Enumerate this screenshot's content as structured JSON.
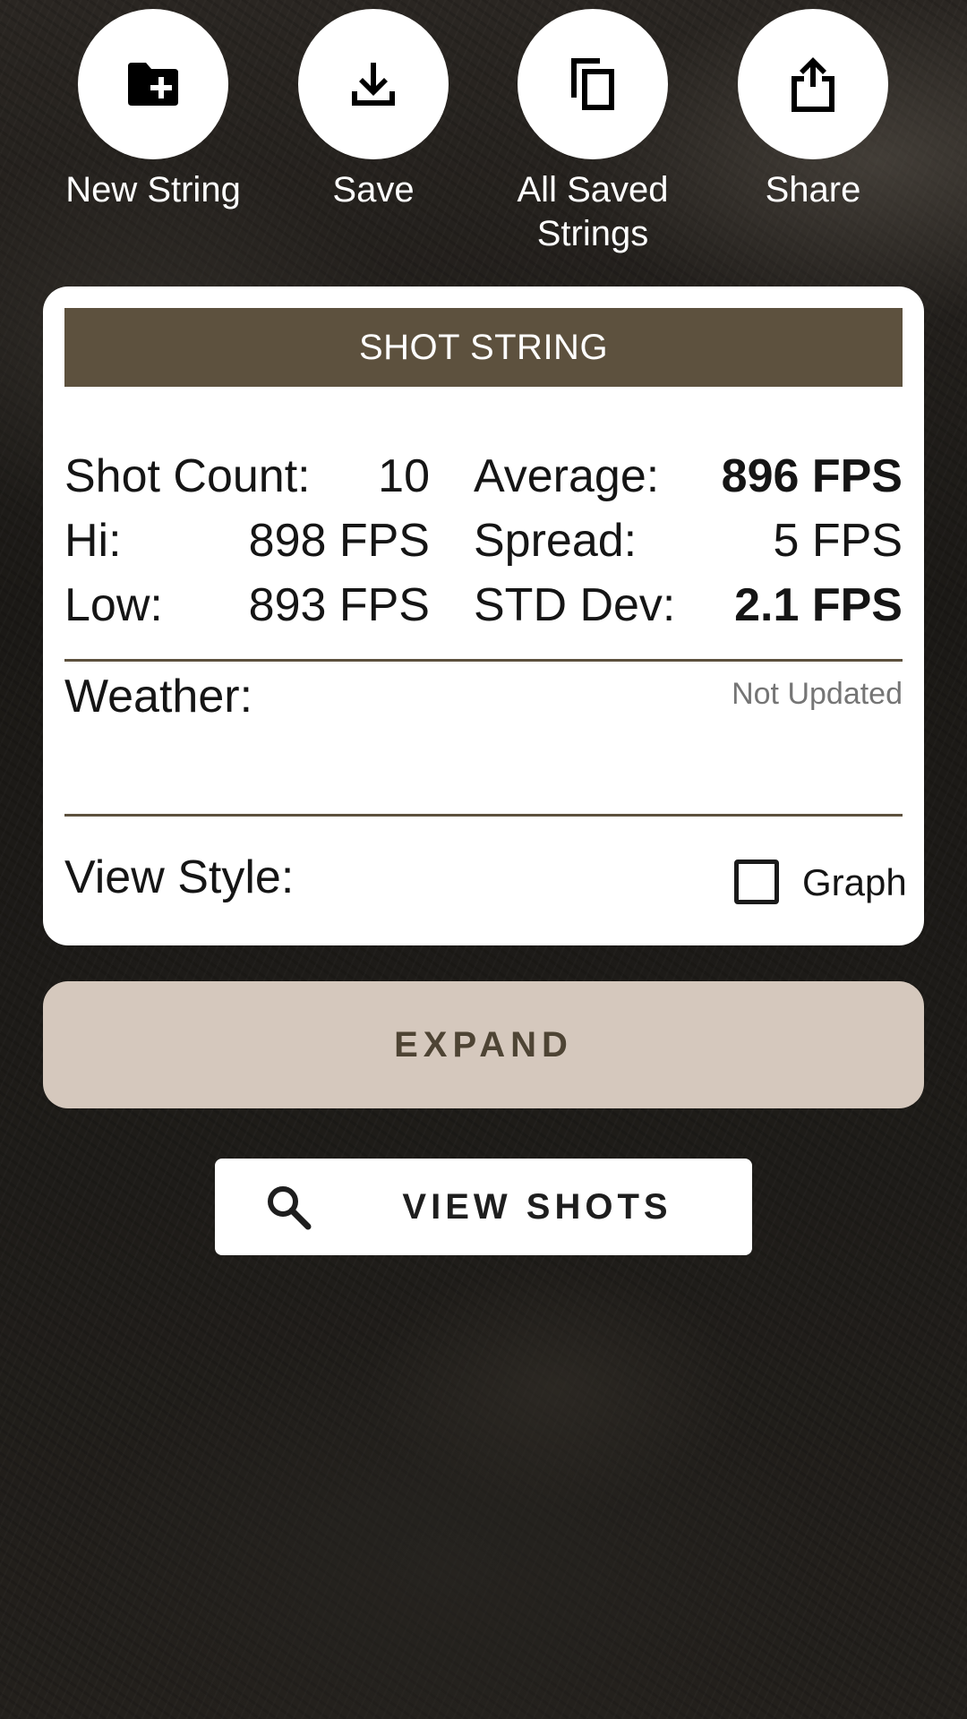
{
  "toolbar": {
    "new_string": "New String",
    "save": "Save",
    "all_saved_line1": "All Saved",
    "all_saved_line2": "Strings",
    "share": "Share"
  },
  "card": {
    "title": "SHOT STRING",
    "shot_count_label": "Shot Count:",
    "shot_count_value": "10",
    "average_label": "Average:",
    "average_value": "896 FPS",
    "hi_label": "Hi:",
    "hi_value": "898 FPS",
    "spread_label": "Spread:",
    "spread_value": "5 FPS",
    "low_label": "Low:",
    "low_value": "893 FPS",
    "std_label": "STD Dev:",
    "std_value": "2.1 FPS",
    "weather_label": "Weather:",
    "weather_status": "Not Updated",
    "view_style_label": "View Style:",
    "graph_label": "Graph",
    "graph_checked": false
  },
  "expand_label": "EXPAND",
  "view_shots_label": "VIEW SHOTS",
  "icons": {
    "new_string": "create-new-folder-icon",
    "save": "download-icon",
    "all_saved": "copy-icon",
    "share": "share-icon",
    "view_shots": "search-icon"
  },
  "colors": {
    "header_bg": "#5d513e",
    "expand_bg": "#d5c8bd",
    "expand_text": "#4e4434"
  }
}
